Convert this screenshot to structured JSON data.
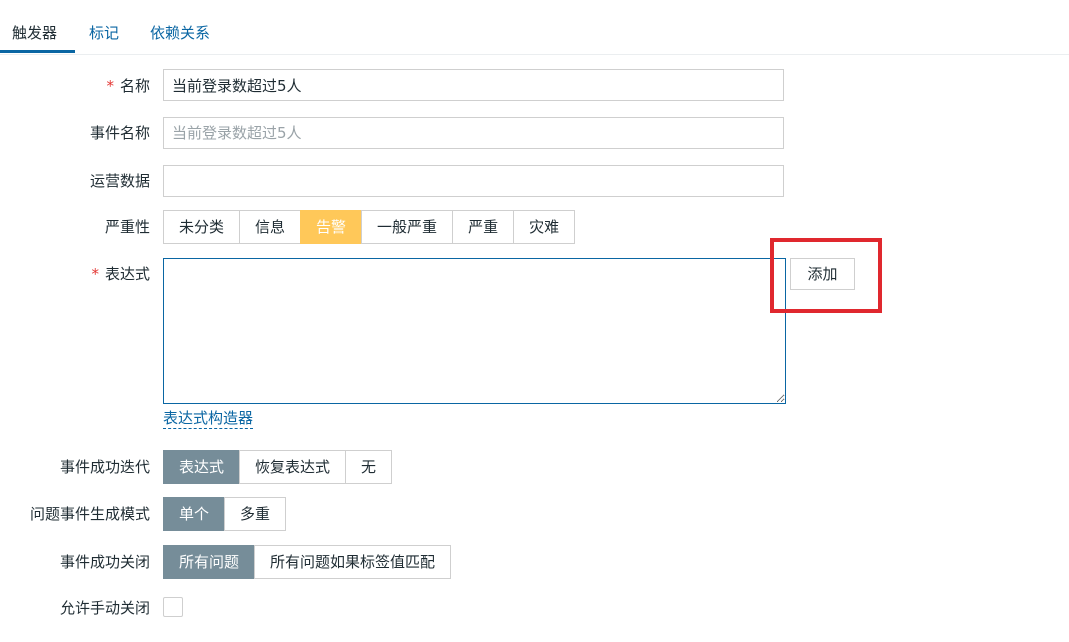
{
  "tabs": [
    {
      "label": "触发器",
      "active": true
    },
    {
      "label": "标记",
      "active": false
    },
    {
      "label": "依赖关系",
      "active": false
    }
  ],
  "form": {
    "name": {
      "label": "名称",
      "required_mark": "*",
      "value": "当前登录数超过5人"
    },
    "event_name": {
      "label": "事件名称",
      "placeholder": "当前登录数超过5人"
    },
    "opdata": {
      "label": "运营数据",
      "value": ""
    },
    "severity": {
      "label": "严重性",
      "options": [
        "未分类",
        "信息",
        "告警",
        "一般严重",
        "严重",
        "灾难"
      ],
      "selected": "告警"
    },
    "expression": {
      "label": "表达式",
      "required_mark": "*",
      "value": "",
      "add_button": "添加",
      "builder_link": "表达式构造器"
    },
    "recovery": {
      "label": "事件成功迭代",
      "options": [
        "表达式",
        "恢复表达式",
        "无"
      ],
      "selected": "表达式"
    },
    "problem_mode": {
      "label": "问题事件生成模式",
      "options": [
        "单个",
        "多重"
      ],
      "selected": "单个"
    },
    "ok_close": {
      "label": "事件成功关闭",
      "options": [
        "所有问题",
        "所有问题如果标签值匹配"
      ],
      "selected": "所有问题"
    },
    "manual_close": {
      "label": "允许手动关闭",
      "checked": false
    }
  },
  "colors": {
    "link": "#0a66a3",
    "warning_selected": "#ffc859",
    "segment_selected": "#768d99",
    "highlight_box": "#e0282e",
    "required": "#e33734"
  }
}
